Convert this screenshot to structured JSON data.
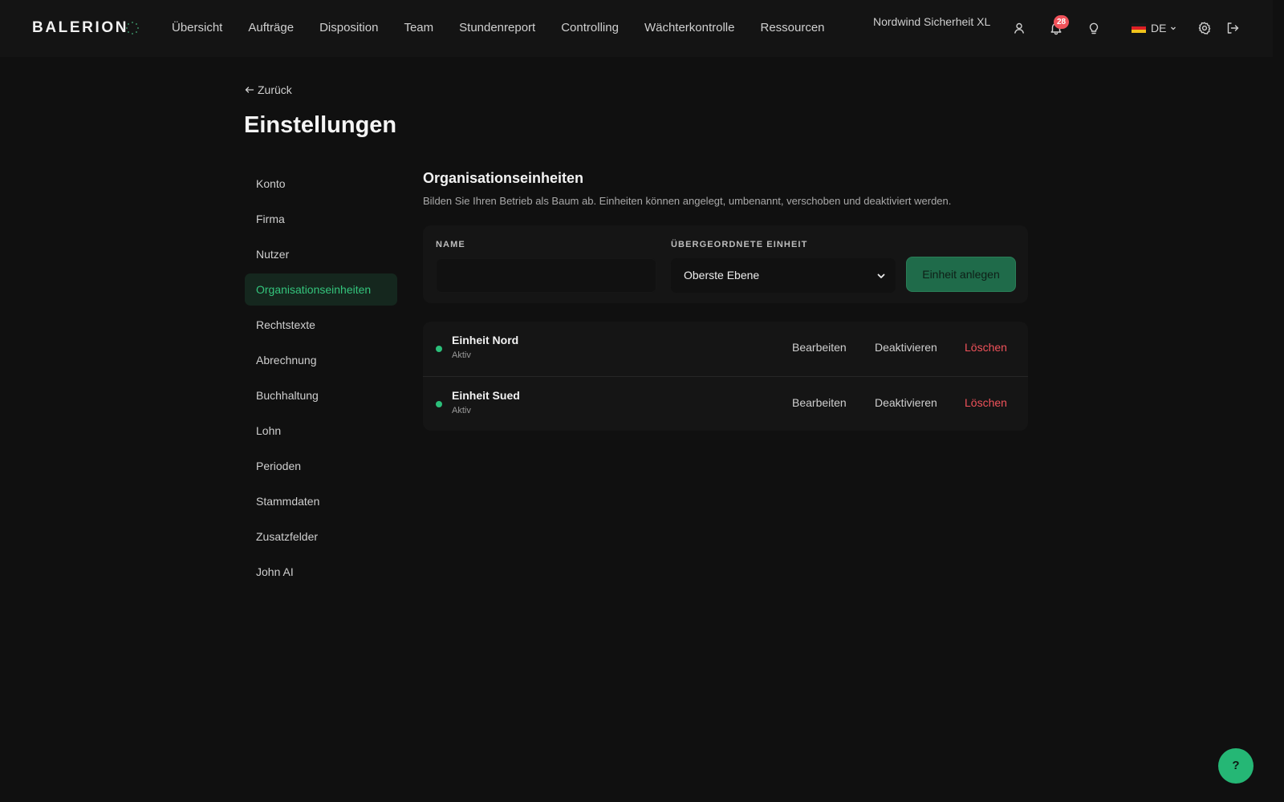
{
  "app": {
    "brand": "BALERION",
    "org_name": "Nordwind Sicherheit XL",
    "notification_count": "28",
    "language": "DE"
  },
  "nav": {
    "items": [
      {
        "label": "Übersicht"
      },
      {
        "label": "Aufträge"
      },
      {
        "label": "Disposition"
      },
      {
        "label": "Team"
      },
      {
        "label": "Stundenreport"
      },
      {
        "label": "Controlling"
      },
      {
        "label": "Wächterkontrolle"
      },
      {
        "label": "Ressourcen"
      }
    ]
  },
  "icons": {
    "user": "user-icon",
    "notifications": "bell-icon",
    "tips": "lightbulb-icon",
    "settings": "gear-icon",
    "logout": "logout-icon",
    "flag": "germany-flag-icon"
  },
  "page": {
    "back_label": "Zurück",
    "title": "Einstellungen"
  },
  "sidenav": {
    "items": [
      {
        "label": "Konto"
      },
      {
        "label": "Firma"
      },
      {
        "label": "Nutzer"
      },
      {
        "label": "Organisationseinheiten",
        "active": true
      },
      {
        "label": "Rechtstexte"
      },
      {
        "label": "Abrechnung"
      },
      {
        "label": "Buchhaltung"
      },
      {
        "label": "Lohn"
      },
      {
        "label": "Perioden"
      },
      {
        "label": "Stammdaten"
      },
      {
        "label": "Zusatzfelder"
      },
      {
        "label": "John AI"
      }
    ]
  },
  "section": {
    "title": "Organisationseinheiten",
    "description": "Bilden Sie Ihren Betrieb als Baum ab. Einheiten können angelegt, umbenannt, verschoben und deaktiviert werden."
  },
  "form": {
    "name_label": "NAME",
    "name_value": "",
    "parent_label": "ÜBERGEORDNETE EINHEIT",
    "parent_value": "Oberste Ebene",
    "submit_label": "Einheit anlegen"
  },
  "units": [
    {
      "name": "Einheit Nord",
      "status": "Aktiv",
      "edit": "Bearbeiten",
      "deactivate": "Deaktivieren",
      "delete": "Löschen"
    },
    {
      "name": "Einheit Sued",
      "status": "Aktiv",
      "edit": "Bearbeiten",
      "deactivate": "Deaktivieren",
      "delete": "Löschen"
    }
  ],
  "help": {
    "label": "?"
  },
  "colors": {
    "background": "#101010",
    "accent": "#2bbf7a",
    "danger": "#f0525a",
    "active_nav_bg": "#15271e"
  }
}
